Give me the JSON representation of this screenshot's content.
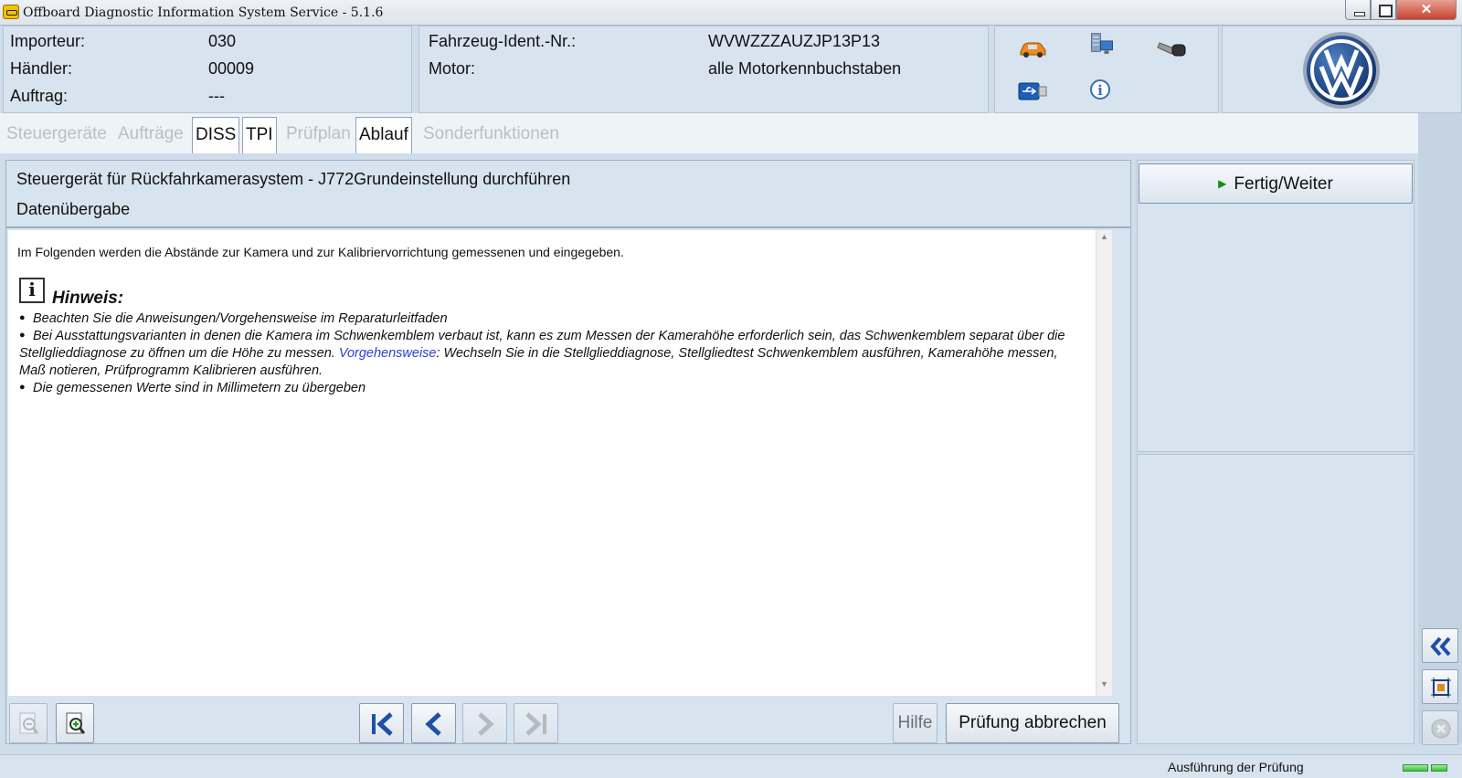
{
  "window": {
    "title": "Offboard Diagnostic Information System Service - 5.1.6"
  },
  "header": {
    "importeur_label": "Importeur:",
    "importeur_value": "030",
    "haendler_label": "Händler:",
    "haendler_value": "00009",
    "auftrag_label": "Auftrag:",
    "auftrag_value": "---",
    "fin_label": "Fahrzeug-Ident.-Nr.:",
    "fin_value": "WVWZZZAUZJP13P13",
    "motor_label": "Motor:",
    "motor_value": "alle Motorkennbuchstaben",
    "icons": [
      "car-icon",
      "network-computer-icon",
      "key-icon",
      "usb-icon",
      "info-icon"
    ]
  },
  "tabs": [
    {
      "label": "Steuergeräte",
      "active": false
    },
    {
      "label": "Aufträge",
      "active": false
    },
    {
      "label": "DISS",
      "active": true
    },
    {
      "label": "TPI",
      "active": true
    },
    {
      "label": "Prüfplan",
      "active": false
    },
    {
      "label": "Ablauf",
      "active": true
    },
    {
      "label": "Sonderfunktionen",
      "active": false
    }
  ],
  "main": {
    "title": "Steuergerät für Rückfahrkamerasystem - J772Grundeinstellung durchführen",
    "subtitle": "Datenübergabe",
    "intro": "Im Folgenden werden die Abstände zur Kamera und zur Kalibriervorrichtung gemessenen und eingegeben.",
    "hinweis": "Hinweis:",
    "bullet1": "Beachten Sie die Anweisungen/Vorgehensweise im Reparaturleitfaden",
    "bullet2_a": "Bei Ausstattungsvarianten in denen die Kamera im Schwenkemblem verbaut ist, kann es zum Messen der Kamerahöhe erforderlich sein, das Schwenkemblem separat über die Stellglieddiagnose zu öffnen um die Höhe zu messen. ",
    "bullet2_link": "Vorgehensweise",
    "bullet2_b": ": Wechseln Sie in die Stellglieddiagnose, Stellgliedtest Schwenkemblem ausführen, Kamerahöhe messen, Maß notieren, Prüfprogramm Kalibrieren ausführen.",
    "bullet3": "Die gemessenen Werte sind in Millimetern zu übergeben"
  },
  "toolbar": {
    "hilfe_label": "Hilfe",
    "abbrechen_label": "Prüfung abbrechen"
  },
  "right": {
    "fertig_label": "Fertig/Weiter"
  },
  "status": {
    "text": "Ausführung der Prüfung"
  },
  "colors": {
    "link": "#2a3fd0",
    "play": "#1a8a1a",
    "progress": "#39c139"
  }
}
